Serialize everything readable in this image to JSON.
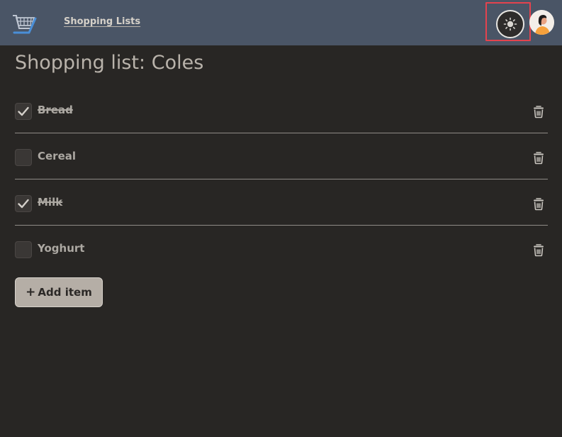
{
  "header": {
    "nav_link": "Shopping Lists",
    "logo_icon": "shopping-cart-icon",
    "theme_icon": "sun-icon",
    "avatar": "user-avatar",
    "highlight_color": "#e4434e"
  },
  "page": {
    "title": "Shopping list: Coles"
  },
  "items": [
    {
      "label": "Bread",
      "checked": true
    },
    {
      "label": "Cereal",
      "checked": false
    },
    {
      "label": "Milk",
      "checked": true
    },
    {
      "label": "Yoghurt",
      "checked": false
    }
  ],
  "actions": {
    "add_item_icon": "+",
    "add_item_label": "Add item"
  },
  "colors": {
    "header_bg": "#4a5566",
    "page_bg": "#282624",
    "button_bg": "#b5aea6"
  }
}
